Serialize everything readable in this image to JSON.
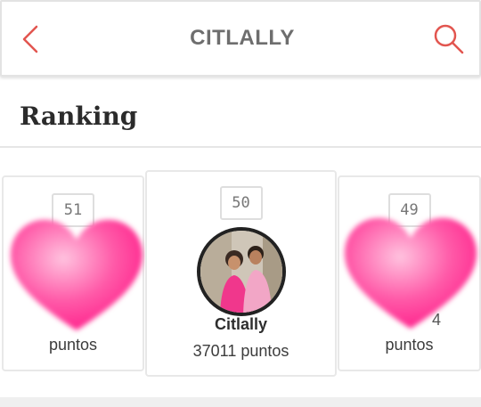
{
  "header": {
    "title": "CITLALLY",
    "back_icon": "chevron-left-icon",
    "search_icon": "search-icon",
    "accent_color": "#e2554f"
  },
  "section": {
    "title": "Ranking"
  },
  "ranking": [
    {
      "rank": "51",
      "name": "",
      "points_label": "puntos",
      "masked": true
    },
    {
      "rank": "50",
      "name": "Citlally",
      "points_label": "37011 puntos",
      "masked": false
    },
    {
      "rank": "49",
      "name": "",
      "points_label": "puntos",
      "masked": true,
      "partial": "4"
    }
  ],
  "colors": {
    "heart_pink": "#ff3d9a",
    "card_border": "#e8e8e8"
  }
}
